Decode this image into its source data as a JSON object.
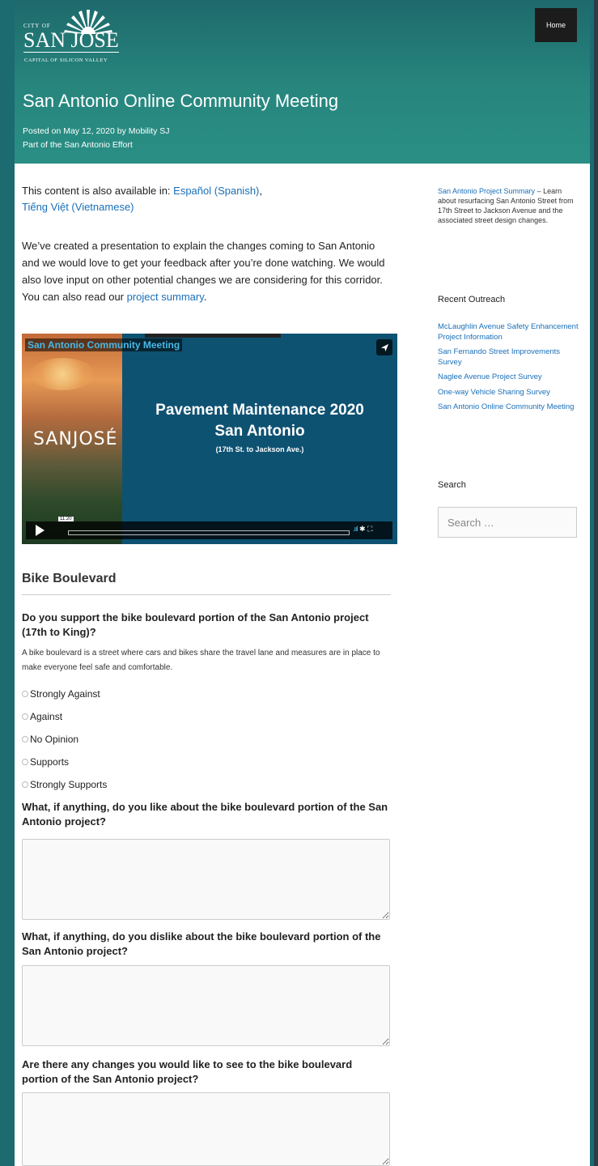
{
  "header": {
    "logo": {
      "line1": "CITY OF",
      "line2": "SAN JOSE",
      "line3": "CAPITAL OF SILICON VALLEY"
    },
    "nav_home": "Home",
    "title": "San Antonio Online Community Meeting",
    "meta_posted": "Posted on May 12, 2020 by Mobility SJ",
    "meta_part": "Part of the San Antonio Effort"
  },
  "article": {
    "lang_prefix": "This content is also available in: ",
    "lang_spanish": "Español (Spanish)",
    "lang_sep": ",",
    "lang_vietnamese": "Tiếng Việt (Vietnamese)",
    "intro_text": "We’ve created a presentation to explain the changes coming to San Antonio and we would love to get your feedback after you’re done watching. We would also love input on other potential changes we are considering for this corridor. You can also read our ",
    "intro_link": "project summary",
    "intro_end": ".",
    "video": {
      "title": "San Antonio Community Meeting",
      "logo_text": "SANJOSÉ",
      "headline1": "Pavement Maintenance 2020",
      "headline2": "San Antonio",
      "headline3": "(17th St. to Jackson Ave.)",
      "time": "11:20",
      "vol_icon": "signal-bars-icon",
      "settings_icon": "gear-icon",
      "fullscreen_icon": "expand-icon"
    },
    "section_title": "Bike Boulevard",
    "q1": "Do you support the bike boulevard portion of the San Antonio project (17th to King)?",
    "q1_desc": "A bike boulevard is a street where cars and bikes share the travel lane and measures are in place to make everyone feel safe and comfortable.",
    "options": [
      "Strongly Against",
      "Against",
      "No Opinion",
      "Supports",
      "Strongly Supports"
    ],
    "q2": "What, if anything, do you like about the bike boulevard portion of the San Antonio project?",
    "q3": "What, if anything, do you dislike about the bike boulevard portion of the San Antonio project?",
    "q4": "Are there any changes you would like to see to the bike boulevard portion of the San Antonio project?"
  },
  "sidebar": {
    "summary_link": "San Antonio Project Summary",
    "summary_text": " – Learn about resurfacing San Antonio Street from 17th Street to Jackson Avenue and the associated street design changes.",
    "recent_title": "Recent Outreach",
    "recent": [
      "McLaughlin Avenue Safety Enhancement Project Information",
      "San Fernando Street Improvements Survey",
      "Naglee Avenue Project Survey",
      "One-way Vehicle Sharing Survey",
      "San Antonio Online Community Meeting"
    ],
    "search_title": "Search",
    "search_placeholder": "Search …"
  }
}
